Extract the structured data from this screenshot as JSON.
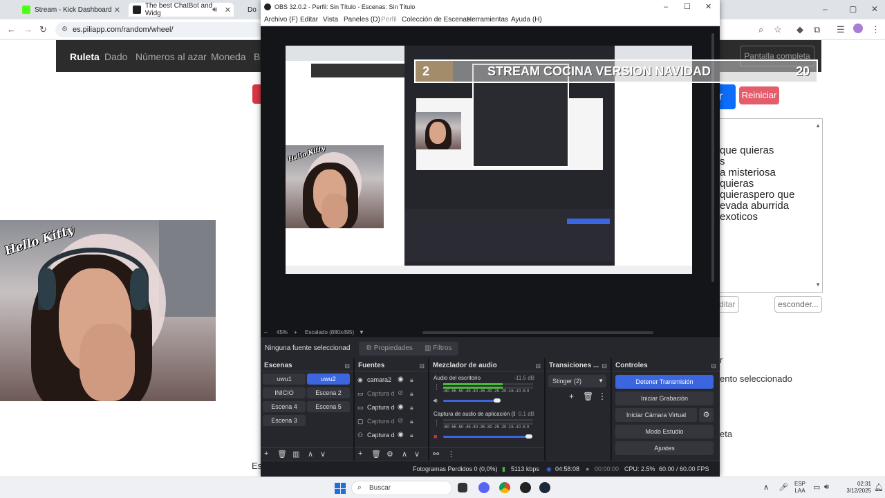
{
  "browser": {
    "tabs": [
      {
        "title": "Stream - Kick Dashboard",
        "color": "#53fc18"
      },
      {
        "title": "The best ChatBot and Widg",
        "color": "#222222"
      },
      {
        "title": "Do",
        "color": "#3a5bd9"
      }
    ],
    "url": "es.piliapp.com/random/wheel/"
  },
  "site": {
    "nav": [
      "Ruleta",
      "Dado",
      "Números al azar",
      "Moneda",
      "Ba"
    ],
    "fullscreen_label": "Pantalla completa",
    "spin_label": "r",
    "reset_label": "Reiniciar",
    "textarea_lines": [
      "que quieras",
      "s",
      "a misteriosa",
      "quieras",
      "quieraspero que",
      "evada aburrida",
      "exoticos"
    ],
    "edit_label": "ditar",
    "hide_label": "esconder...",
    "side_texts": [
      "r",
      "ento seleccionado",
      "eta",
      "Es"
    ]
  },
  "overlay": {
    "banner_left": "2",
    "banner_text": "STREAM COCINA VERSION NAVIDAD",
    "banner_right": "20",
    "cam_text": "Hello Kitty"
  },
  "obs": {
    "title": "OBS 32.0.2 - Perfil: Sin Título - Escenas: Sin Título",
    "menu": [
      "Archivo (F)",
      "Editar",
      "Vista",
      "Paneles (D)",
      "Perfil",
      "Colección de Escenas",
      "Herramientas",
      "Ayuda (H)"
    ],
    "zoom": "45%",
    "scaling": "Escalado (880x495)",
    "no_source": "Ninguna fuente seleccionad",
    "properties": "Propiedades",
    "filters": "Filtros",
    "docks": {
      "scenes": "Escenas",
      "sources": "Fuentes",
      "mixer": "Mezclador de audio",
      "transitions": "Transiciones ...",
      "controls": "Controles"
    },
    "scenes": [
      "uwu1",
      "uwu2",
      "INICIO",
      "Escena 2",
      "Escena 4",
      "Escena 5",
      "Escena 3"
    ],
    "selected_scene": "uwu2",
    "sources": [
      {
        "name": "camara2",
        "icon": "camera-icon"
      },
      {
        "name": "Captura de",
        "icon": "monitor-icon"
      },
      {
        "name": "Captura de",
        "icon": "monitor-icon"
      },
      {
        "name": "Captura de",
        "icon": "window-icon"
      },
      {
        "name": "Captura de",
        "icon": "gamepad-icon"
      }
    ],
    "mixer": [
      {
        "name": "Audio del escritorio",
        "db": "-11.5 dB",
        "level": 0.66,
        "volume": 0.6
      },
      {
        "name": "Captura de audio de aplicación (BE",
        "db": "0.1 dB",
        "level": 0.0,
        "volume": 0.95
      }
    ],
    "meter_scale": "-60 -55 -50 -45 -40 -35 -30 -25 -20 -15 -10 -5 0",
    "transition": "Stinger (2)",
    "controls": [
      "Detener Transmisión",
      "Iniciar Grabación",
      "Iniciar Cámara Virtual",
      "Modo Estudio",
      "Ajustes"
    ],
    "status": {
      "dropped": "Fotogramas Perdidos 0 (0,0%)",
      "bitrate": "5113 kbps",
      "stream_time": "04:58:08",
      "rec_time": "00:00:00",
      "cpu": "CPU: 2.5%",
      "fps": "60.00 / 60.00 FPS"
    },
    "accent": "#3c66e0"
  },
  "taskbar": {
    "search": "Buscar",
    "lang": "ESP",
    "region": "LAA",
    "time": "02:31",
    "date": "3/12/2025"
  }
}
